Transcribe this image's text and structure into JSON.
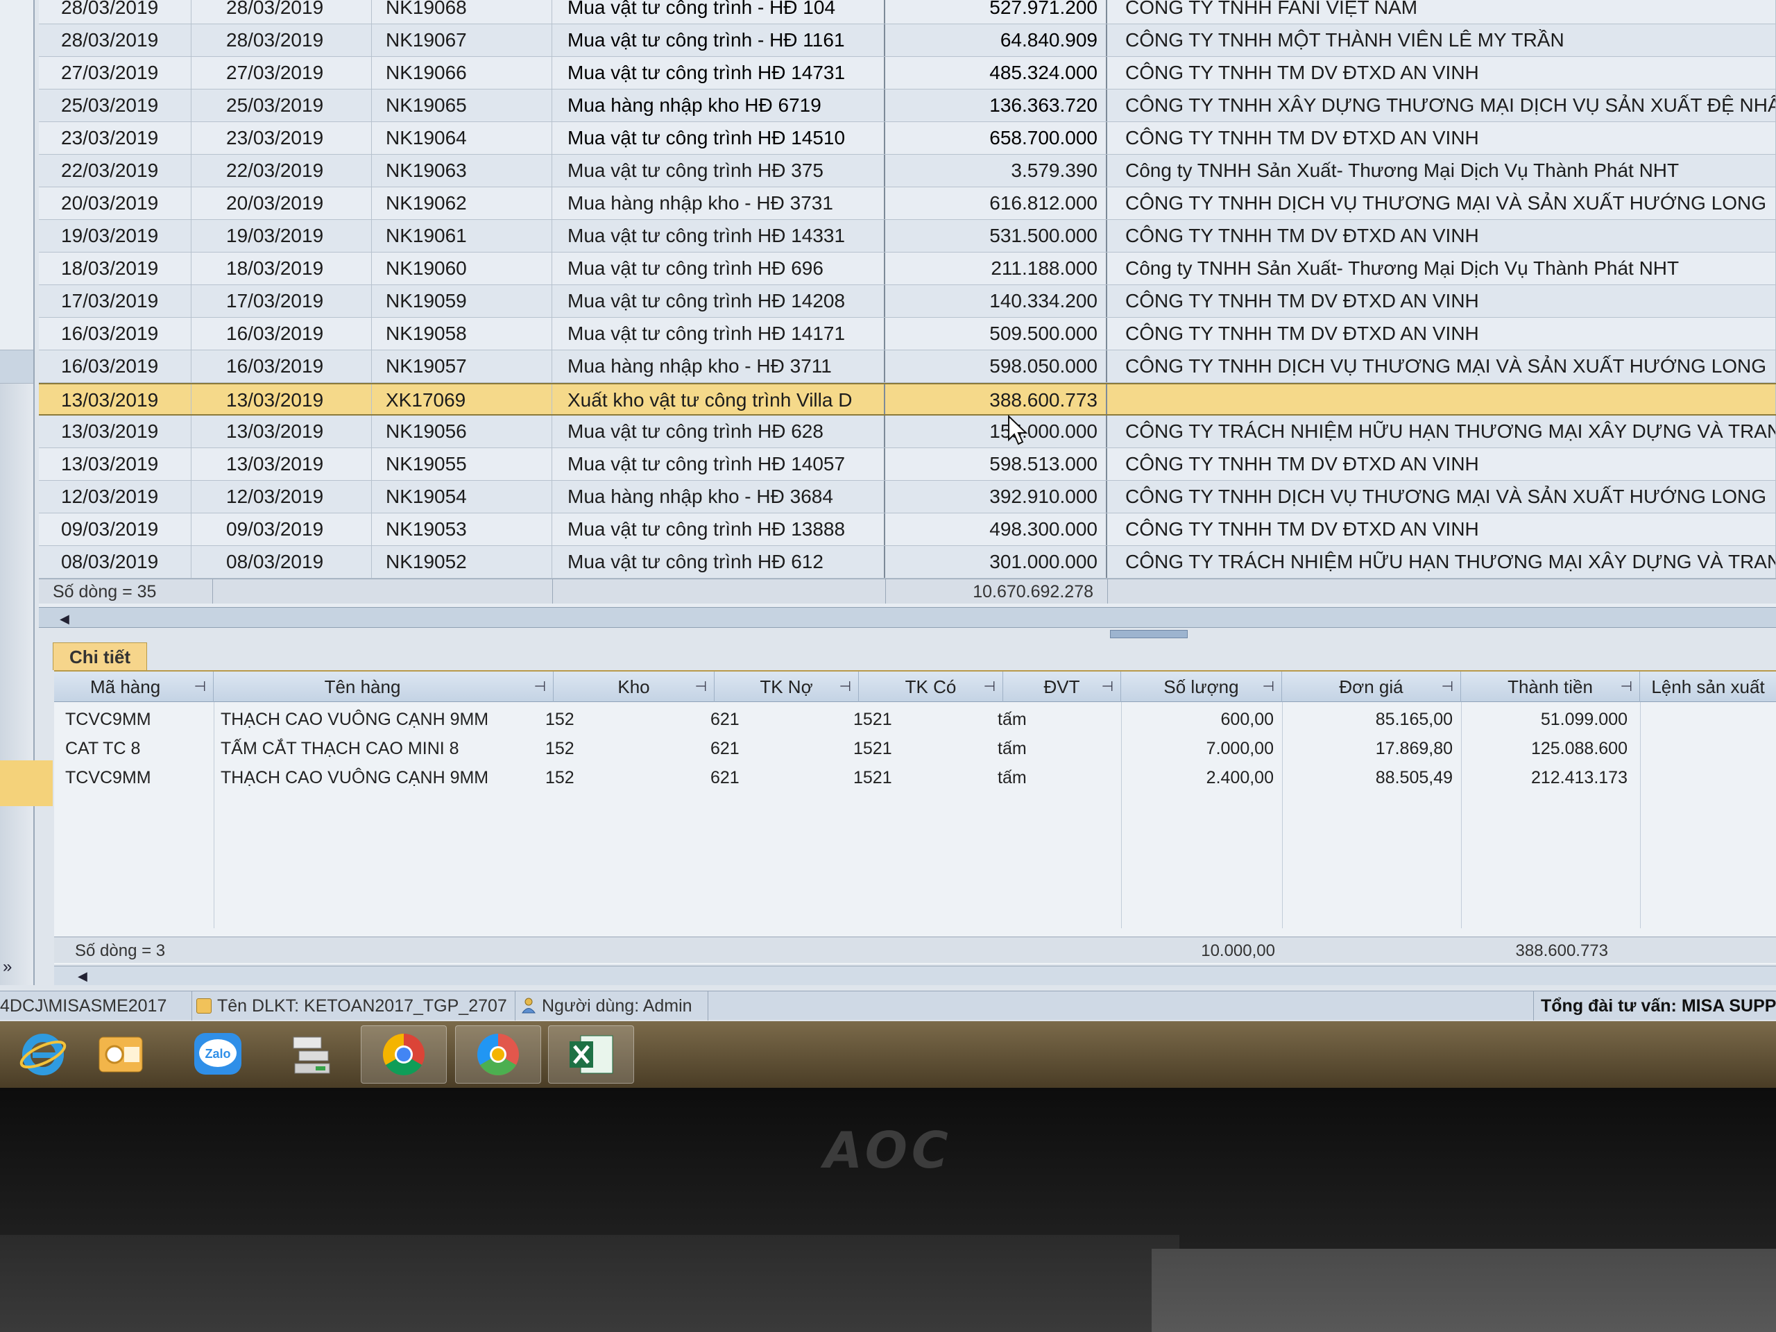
{
  "master": {
    "rows": [
      {
        "ngay_hach_toan": "28/03/2019",
        "ngay_chung_tu": "28/03/2019",
        "so_chung_tu": "NK19068",
        "dien_giai": "Mua vật tư công trình - HĐ 104",
        "tong_tien": "527.971.200",
        "doi_tuong": "CÔNG TY TNHH FANI VIỆT NAM"
      },
      {
        "ngay_hach_toan": "28/03/2019",
        "ngay_chung_tu": "28/03/2019",
        "so_chung_tu": "NK19067",
        "dien_giai": "Mua vật tư công trình - HĐ 1161",
        "tong_tien": "64.840.909",
        "doi_tuong": "CÔNG TY TNHH MỘT THÀNH VIÊN LÊ MY TRẦN"
      },
      {
        "ngay_hach_toan": "27/03/2019",
        "ngay_chung_tu": "27/03/2019",
        "so_chung_tu": "NK19066",
        "dien_giai": "Mua vật tư công trình HĐ 14731",
        "tong_tien": "485.324.000",
        "doi_tuong": "CÔNG TY TNHH TM DV ĐTXD AN VINH"
      },
      {
        "ngay_hach_toan": "25/03/2019",
        "ngay_chung_tu": "25/03/2019",
        "so_chung_tu": "NK19065",
        "dien_giai": "Mua hàng nhập kho HĐ 6719",
        "tong_tien": "136.363.720",
        "doi_tuong": "CÔNG TY TNHH XÂY DỰNG THƯƠNG MẠI DỊCH VỤ SẢN XUẤT ĐỆ NHẤ"
      },
      {
        "ngay_hach_toan": "23/03/2019",
        "ngay_chung_tu": "23/03/2019",
        "so_chung_tu": "NK19064",
        "dien_giai": "Mua vật tư công trình HĐ 14510",
        "tong_tien": "658.700.000",
        "doi_tuong": "CÔNG TY TNHH TM DV ĐTXD AN VINH"
      },
      {
        "ngay_hach_toan": "22/03/2019",
        "ngay_chung_tu": "22/03/2019",
        "so_chung_tu": "NK19063",
        "dien_giai": "Mua vật tư công trình HĐ 375",
        "tong_tien": "3.579.390",
        "doi_tuong": "Công ty TNHH Sản Xuất- Thương Mại Dịch Vụ Thành Phát NHT"
      },
      {
        "ngay_hach_toan": "20/03/2019",
        "ngay_chung_tu": "20/03/2019",
        "so_chung_tu": "NK19062",
        "dien_giai": "Mua hàng nhập kho - HĐ 3731",
        "tong_tien": "616.812.000",
        "doi_tuong": "CÔNG TY TNHH DỊCH VỤ THƯƠNG MẠI VÀ SẢN XUẤT HƯỚNG LONG"
      },
      {
        "ngay_hach_toan": "19/03/2019",
        "ngay_chung_tu": "19/03/2019",
        "so_chung_tu": "NK19061",
        "dien_giai": "Mua vật tư công trình HĐ 14331",
        "tong_tien": "531.500.000",
        "doi_tuong": "CÔNG TY TNHH TM DV ĐTXD AN VINH"
      },
      {
        "ngay_hach_toan": "18/03/2019",
        "ngay_chung_tu": "18/03/2019",
        "so_chung_tu": "NK19060",
        "dien_giai": "Mua vật tư công trình HĐ 696",
        "tong_tien": "211.188.000",
        "doi_tuong": "Công ty TNHH Sản Xuất- Thương Mại Dịch Vụ Thành Phát NHT"
      },
      {
        "ngay_hach_toan": "17/03/2019",
        "ngay_chung_tu": "17/03/2019",
        "so_chung_tu": "NK19059",
        "dien_giai": "Mua vật tư công trình HĐ 14208",
        "tong_tien": "140.334.200",
        "doi_tuong": "CÔNG TY TNHH TM DV ĐTXD AN VINH"
      },
      {
        "ngay_hach_toan": "16/03/2019",
        "ngay_chung_tu": "16/03/2019",
        "so_chung_tu": "NK19058",
        "dien_giai": "Mua vật tư công trình HĐ 14171",
        "tong_tien": "509.500.000",
        "doi_tuong": "CÔNG TY TNHH TM DV ĐTXD AN VINH"
      },
      {
        "ngay_hach_toan": "16/03/2019",
        "ngay_chung_tu": "16/03/2019",
        "so_chung_tu": "NK19057",
        "dien_giai": "Mua hàng nhập kho - HĐ 3711",
        "tong_tien": "598.050.000",
        "doi_tuong": "CÔNG TY TNHH DỊCH VỤ THƯƠNG MẠI VÀ SẢN XUẤT HƯỚNG LONG"
      },
      {
        "ngay_hach_toan": "13/03/2019",
        "ngay_chung_tu": "13/03/2019",
        "so_chung_tu": "XK17069",
        "dien_giai": "Xuất kho vật tư công trình Villa D",
        "tong_tien": "388.600.773",
        "doi_tuong": ""
      },
      {
        "ngay_hach_toan": "13/03/2019",
        "ngay_chung_tu": "13/03/2019",
        "so_chung_tu": "NK19056",
        "dien_giai": "Mua vật tư công trình HĐ 628",
        "tong_tien": "155.000.000",
        "doi_tuong": "CÔNG TY TRÁCH NHIỆM HỮU HẠN THƯƠNG MẠI XÂY DỰNG VÀ TRAN"
      },
      {
        "ngay_hach_toan": "13/03/2019",
        "ngay_chung_tu": "13/03/2019",
        "so_chung_tu": "NK19055",
        "dien_giai": "Mua vật tư công trình HĐ 14057",
        "tong_tien": "598.513.000",
        "doi_tuong": "CÔNG TY TNHH TM DV ĐTXD AN VINH"
      },
      {
        "ngay_hach_toan": "12/03/2019",
        "ngay_chung_tu": "12/03/2019",
        "so_chung_tu": "NK19054",
        "dien_giai": "Mua hàng nhập kho - HĐ 3684",
        "tong_tien": "392.910.000",
        "doi_tuong": "CÔNG TY TNHH DỊCH VỤ THƯƠNG MẠI VÀ SẢN XUẤT HƯỚNG LONG"
      },
      {
        "ngay_hach_toan": "09/03/2019",
        "ngay_chung_tu": "09/03/2019",
        "so_chung_tu": "NK19053",
        "dien_giai": "Mua vật tư công trình HĐ 13888",
        "tong_tien": "498.300.000",
        "doi_tuong": "CÔNG TY TNHH TM DV ĐTXD AN VINH"
      },
      {
        "ngay_hach_toan": "08/03/2019",
        "ngay_chung_tu": "08/03/2019",
        "so_chung_tu": "NK19052",
        "dien_giai": "Mua vật tư công trình HĐ 612",
        "tong_tien": "301.000.000",
        "doi_tuong": "CÔNG TY TRÁCH NHIỆM HỮU HẠN THƯƠNG MẠI XÂY DỰNG VÀ TRAN"
      }
    ],
    "selected_index": 12,
    "footer": {
      "count_label": "Số dòng = 35",
      "total": "10.670.692.278"
    }
  },
  "detail": {
    "tab_label": "Chi tiết",
    "columns": [
      "Mã hàng",
      "Tên hàng",
      "Kho",
      "TK Nợ",
      "TK Có",
      "ĐVT",
      "Số lượng",
      "Đơn giá",
      "Thành tiền",
      "Lệnh sản xuất"
    ],
    "rows": [
      {
        "ma_hang": "TCVC9MM",
        "ten_hang": "THẠCH CAO VUÔNG CẠNH 9MM",
        "kho": "152",
        "tk_no": "621",
        "tk_co": "1521",
        "dvt": "tấm",
        "so_luong": "600,00",
        "don_gia": "85.165,00",
        "thanh_tien": "51.099.000"
      },
      {
        "ma_hang": "CAT TC 8",
        "ten_hang": "TẤM CẮT THẠCH CAO MINI 8",
        "kho": "152",
        "tk_no": "621",
        "tk_co": "1521",
        "dvt": "tấm",
        "so_luong": "7.000,00",
        "don_gia": "17.869,80",
        "thanh_tien": "125.088.600"
      },
      {
        "ma_hang": "TCVC9MM",
        "ten_hang": "THẠCH CAO VUÔNG CẠNH 9MM",
        "kho": "152",
        "tk_no": "621",
        "tk_co": "1521",
        "dvt": "tấm",
        "so_luong": "2.400,00",
        "don_gia": "88.505,49",
        "thanh_tien": "212.413.173"
      }
    ],
    "footer": {
      "count_label": "Số dòng = 3",
      "so_luong_total": "10.000,00",
      "thanh_tien_total": "388.600.773"
    }
  },
  "statusbar": {
    "database": "4DCJ\\MISASME2017",
    "dlkt": "Tên DLKT: KETOAN2017_TGP_2707",
    "user": "Người dùng: Admin",
    "hotline": "Tổng đài tư vấn: MISA SUPPC"
  },
  "taskbar": {
    "apps": [
      {
        "icon": "internet-explorer-icon"
      },
      {
        "icon": "outlook-icon"
      },
      {
        "icon": "zalo-icon",
        "label": "Zalo"
      },
      {
        "icon": "file-manager-icon"
      },
      {
        "icon": "chrome-icon"
      },
      {
        "icon": "chrome-canary-icon"
      },
      {
        "icon": "excel-icon"
      }
    ]
  },
  "monitor": {
    "brand": "AOC"
  }
}
